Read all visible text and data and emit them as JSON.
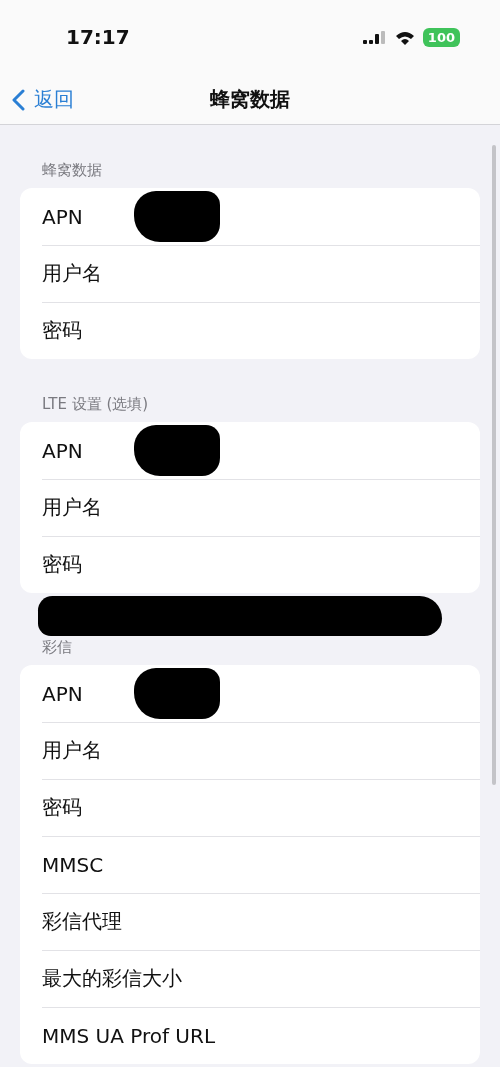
{
  "status_bar": {
    "time": "17:17",
    "battery": "100"
  },
  "nav": {
    "back": "返回",
    "title": "蜂窝数据"
  },
  "sections": [
    {
      "header": "蜂窝数据",
      "rows": [
        {
          "label": "APN",
          "redacted": true
        },
        {
          "label": "用户名",
          "redacted": false
        },
        {
          "label": "密码",
          "redacted": false
        }
      ]
    },
    {
      "header": "LTE 设置 (选填)",
      "redacted_below": true,
      "rows": [
        {
          "label": "APN",
          "redacted": true
        },
        {
          "label": "用户名",
          "redacted": false
        },
        {
          "label": "密码",
          "redacted": false
        }
      ]
    },
    {
      "header": "彩信",
      "rows": [
        {
          "label": "APN",
          "redacted": true
        },
        {
          "label": "用户名",
          "redacted": false
        },
        {
          "label": "密码",
          "redacted": false
        },
        {
          "label": "MMSC",
          "redacted": false
        },
        {
          "label": "彩信代理",
          "redacted": false
        },
        {
          "label": "最大的彩信大小",
          "redacted": false
        },
        {
          "label": "MMS UA Prof URL",
          "redacted": false
        }
      ]
    }
  ]
}
